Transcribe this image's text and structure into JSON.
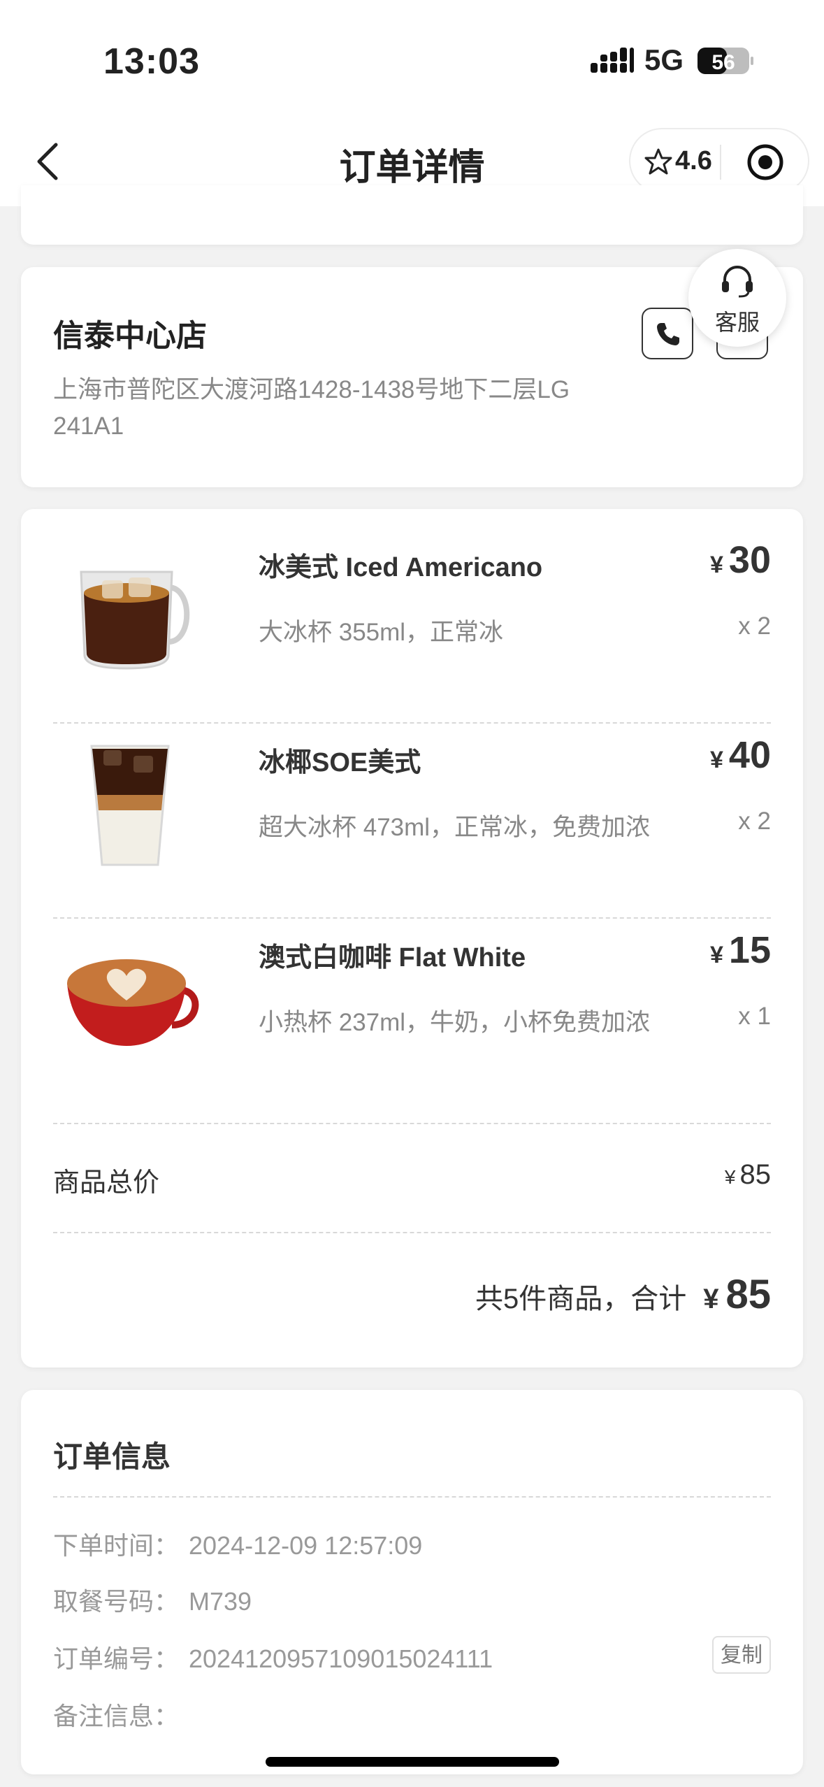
{
  "status_bar": {
    "time": "13:03",
    "network": "5G",
    "battery": "56"
  },
  "nav": {
    "title": "订单详情",
    "rating": "4.6"
  },
  "store": {
    "name": "信泰中心店",
    "address": "上海市普陀区大渡河路1428-1438号地下二层LG 241A1",
    "service_label": "客服"
  },
  "items": [
    {
      "name": "冰美式 Iced Americano",
      "spec": "大冰杯 355ml，正常冰",
      "currency": "¥",
      "price": "30",
      "qty": "x 2"
    },
    {
      "name": "冰椰SOE美式",
      "spec": "超大冰杯 473ml，正常冰，免费加浓",
      "currency": "¥",
      "price": "40",
      "qty": "x 2"
    },
    {
      "name": "澳式白咖啡 Flat White",
      "spec": "小热杯 237ml，牛奶，小杯免费加浓",
      "currency": "¥",
      "price": "15",
      "qty": "x 1"
    }
  ],
  "summary": {
    "subtotal_label": "商品总价",
    "subtotal_currency": "¥",
    "subtotal_value": "85",
    "total_text": "共5件商品，合计",
    "total_currency": "¥",
    "total_value": "85"
  },
  "order_info": {
    "title": "订单信息",
    "rows": [
      {
        "label": "下单时间：",
        "value": "2024-12-09 12:57:09"
      },
      {
        "label": "取餐号码：",
        "value": "M739"
      },
      {
        "label": "订单编号：",
        "value": "2024120957109015024111"
      },
      {
        "label": "备注信息：",
        "value": ""
      }
    ],
    "copy_label": "复制"
  }
}
